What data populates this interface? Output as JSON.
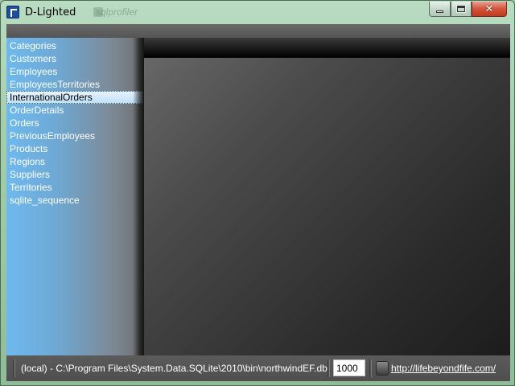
{
  "window": {
    "title": "D-Lighted",
    "background_title": "sqlprofiler",
    "controls": {
      "minimize": "minimize",
      "maximize": "maximize",
      "close": "✕"
    }
  },
  "sidebar": {
    "tables": [
      "Categories",
      "Customers",
      "Employees",
      "EmployeesTerritories",
      "InternationalOrders",
      "OrderDetails",
      "Orders",
      "PreviousEmployees",
      "Products",
      "Regions",
      "Suppliers",
      "Territories",
      "sqlite_sequence"
    ],
    "selected_index": 4
  },
  "statusbar": {
    "connection": "(local) - C:\\Program Files\\System.Data.SQLite\\2010\\bin\\northwindEF.db",
    "row_limit": "1000",
    "link_icon": "database-icon",
    "link_text": "http://lifebeyondfife.com/"
  },
  "colors": {
    "sidebar_gradient_start": "#6fb9ee",
    "selected_item_bg": "#bfe0f7",
    "main_pane_dark": "#1c1c1c",
    "close_button": "#c13a20"
  }
}
